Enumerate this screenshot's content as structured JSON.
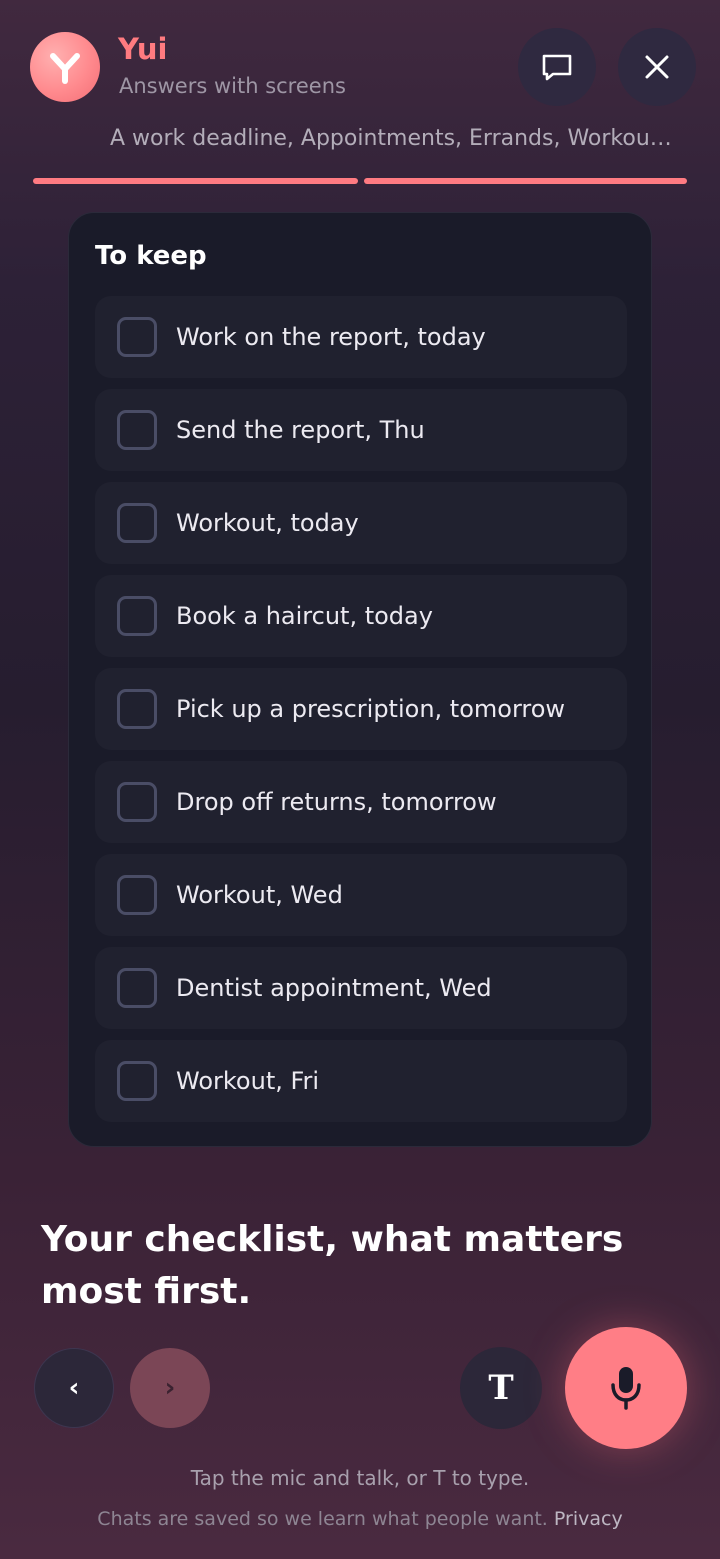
{
  "header": {
    "app_name": "Yui",
    "subtitle": "Answers with screens",
    "avatar_icon": "yui-logo-icon",
    "chat_icon": "chat-bubble-icon",
    "close_icon": "close-icon"
  },
  "topics": "A work deadline, Appointments, Errands, Workou…",
  "progress_steps": [
    {
      "label": "step-1",
      "complete": true
    },
    {
      "label": "step-2",
      "complete": true
    }
  ],
  "card": {
    "title": "To keep",
    "items": [
      {
        "label": "Work on the report, today",
        "checked": false
      },
      {
        "label": "Send the report, Thu",
        "checked": false
      },
      {
        "label": "Workout, today",
        "checked": false
      },
      {
        "label": "Book a haircut, today",
        "checked": false
      },
      {
        "label": "Pick up a prescription, tomorrow",
        "checked": false
      },
      {
        "label": "Drop off returns, tomorrow",
        "checked": false
      },
      {
        "label": "Workout, Wed",
        "checked": false
      },
      {
        "label": "Dentist appointment, Wed",
        "checked": false
      },
      {
        "label": "Workout, Fri",
        "checked": false
      }
    ]
  },
  "headline": "Your checklist, what matters most first.",
  "controls": {
    "prev_glyph": "‹",
    "next_glyph": "›",
    "type_label": "T",
    "mic_icon": "microphone-icon"
  },
  "hint": "Tap the mic and talk, or T to type.",
  "footer": {
    "text": "Chats are saved so we learn what people want.",
    "privacy_link": "Privacy"
  },
  "colors": {
    "accent": "#ff7b82",
    "card_bg": "#1a1b29",
    "item_bg": "#20212f"
  }
}
